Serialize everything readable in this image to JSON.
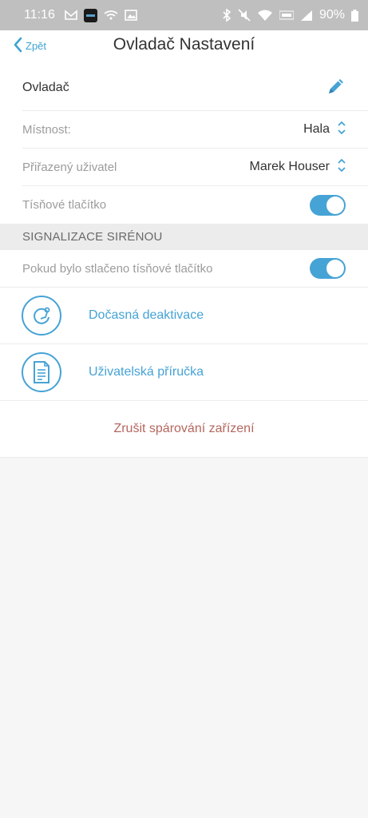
{
  "status_bar": {
    "time": "11:16",
    "battery": "90%",
    "icons": [
      "sim-icon",
      "app-icon",
      "wifi-cast-icon",
      "image-icon",
      "bluetooth-icon",
      "mute-icon",
      "wifi-icon",
      "volte-icon",
      "signal-icon",
      "battery-icon"
    ]
  },
  "nav": {
    "back_label": "Zpět",
    "title": "Ovladač Nastavení"
  },
  "device": {
    "name": "Ovladač"
  },
  "settings": {
    "room_label": "Místnost:",
    "room_value": "Hala",
    "user_label": "Přiřazený uživatel",
    "user_value": "Marek Houser",
    "panic_label": "Tísňové tlačítko"
  },
  "siren_section": {
    "title": "SIGNALIZACE SIRÉNOU",
    "panic_pressed_label": "Pokud bylo stlačeno tísňové tlačítko"
  },
  "actions": {
    "deactivate": "Dočasná deaktivace",
    "manual": "Uživatelská příručka",
    "unpair": "Zrušit spárování zařízení"
  },
  "colors": {
    "accent": "#46a3d5",
    "danger": "#b5665e"
  }
}
